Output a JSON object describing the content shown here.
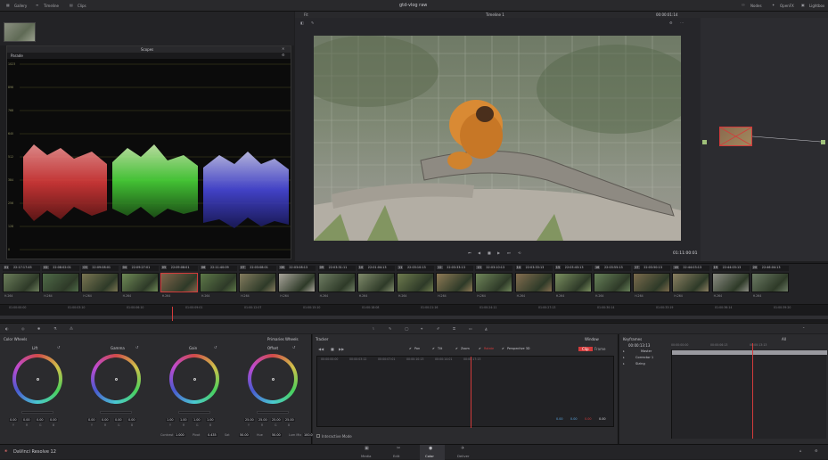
{
  "top_bar": {
    "gallery": "Gallery",
    "timeline": "Timeline",
    "clips": "Clips",
    "project_title": "gtd-vlog raw",
    "nodes": "Nodes",
    "openfx": "OpenFX",
    "lightbox": "Lightbox"
  },
  "scopes": {
    "title": "Scopes",
    "mode": "Parade",
    "y_labels": [
      "1023",
      "896",
      "768",
      "640",
      "512",
      "384",
      "256",
      "128",
      "0"
    ]
  },
  "viewer": {
    "zoom": "Fit",
    "timeline_name": "Timeline 1",
    "timecode_top": "00:00:01:14",
    "timecode": "01:11:00:01"
  },
  "clips": [
    {
      "num": "01",
      "tc": "22:17:17:45",
      "codec": "H.264",
      "color": "#6b7d5a"
    },
    {
      "num": "02",
      "tc": "22:08:02:01",
      "codec": "H.264",
      "color": "#4f6a48"
    },
    {
      "num": "03",
      "tc": "22:09:08:01",
      "codec": "H.264",
      "color": "#7a7552"
    },
    {
      "num": "04",
      "tc": "22:09:27:01",
      "codec": "H.264",
      "color": "#6f8a56"
    },
    {
      "num": "05",
      "tc": "22:09:08:01",
      "codec": "H.264",
      "color": "#80644a"
    },
    {
      "num": "06",
      "tc": "22:11:40:09",
      "codec": "H.264",
      "color": "#5d7848"
    },
    {
      "num": "07",
      "tc": "22:03:08:01",
      "codec": "H.264",
      "color": "#837b5e"
    },
    {
      "num": "08",
      "tc": "22:03:08:13",
      "codec": "H.264",
      "color": "#a8a49a"
    },
    {
      "num": "09",
      "tc": "22:03:31:11",
      "codec": "H.264",
      "color": "#6e7c62"
    },
    {
      "num": "10",
      "tc": "22:01:04:13",
      "codec": "H.264",
      "color": "#7f8a6a"
    },
    {
      "num": "11",
      "tc": "22:03:10:13",
      "codec": "H.264",
      "color": "#6d7a4d"
    },
    {
      "num": "12",
      "tc": "22:03:33:13",
      "codec": "H.264",
      "color": "#8e7a55"
    },
    {
      "num": "13",
      "tc": "22:03:10:13",
      "codec": "H.264",
      "color": "#6f8559"
    },
    {
      "num": "14",
      "tc": "22:03:33:13",
      "codec": "H.264",
      "color": "#836d4f"
    },
    {
      "num": "15",
      "tc": "22:03:43:13",
      "codec": "H.264",
      "color": "#7a8f5f"
    },
    {
      "num": "16",
      "tc": "22:03:55:13",
      "codec": "H.264",
      "color": "#668058"
    },
    {
      "num": "17",
      "tc": "22:03:50:13",
      "codec": "H.264",
      "color": "#7a6a4c"
    },
    {
      "num": "18",
      "tc": "22:44:03:13",
      "codec": "H.264",
      "color": "#8a7f61"
    },
    {
      "num": "19",
      "tc": "22:44:03:13",
      "codec": "H.264",
      "color": "#8b8c83"
    },
    {
      "num": "20",
      "tc": "22:46:04:13",
      "codec": "H.264",
      "color": "#6b7a63"
    }
  ],
  "ruler": [
    "01:00:00:00",
    "01:00:03:10",
    "01:00:06:10",
    "01:00:09:01",
    "01:00:12:07",
    "01:00:15:10",
    "01:00:18:08",
    "01:00:21:16",
    "01:00:24:11",
    "01:00:27:13",
    "01:00:30:14",
    "01:00:33:19",
    "01:00:36:14",
    "01:00:39:20"
  ],
  "color_wheels": {
    "title": "Color Wheels",
    "mode": "Primaries Wheels",
    "wheels": [
      {
        "name": "Lift",
        "vals": [
          "0.00",
          "0.00",
          "0.00",
          "0.00"
        ]
      },
      {
        "name": "Gamma",
        "vals": [
          "0.00",
          "0.00",
          "0.00",
          "0.00"
        ]
      },
      {
        "name": "Gain",
        "vals": [
          "1.00",
          "1.00",
          "1.00",
          "1.00"
        ]
      },
      {
        "name": "Offset",
        "vals": [
          "25.00",
          "25.00",
          "25.00",
          "25.00"
        ]
      }
    ],
    "channel_labels": [
      "Y",
      "R",
      "G",
      "B"
    ],
    "footer": [
      {
        "label": "Contrast",
        "value": "1.000"
      },
      {
        "label": "Pivot",
        "value": "0.435"
      },
      {
        "label": "Sat",
        "value": "50.00"
      },
      {
        "label": "Hue",
        "value": "50.00"
      },
      {
        "label": "Lum Mix",
        "value": "100.00"
      }
    ]
  },
  "tracker": {
    "title": "Tracker",
    "window": "Window",
    "options": [
      "Pan",
      "Tilt",
      "Zoom",
      "Rotate",
      "Perspective 3D"
    ],
    "clip_label": "Clip",
    "frame_label": "Frame",
    "times": [
      "00:00:00:00",
      "00:00:03:12",
      "00:00:07:01",
      "00:00:10:13",
      "00:00:14:01",
      "00:00:17:13"
    ],
    "values": [
      "0.00",
      "0.00",
      "0.00",
      "0.00"
    ],
    "interactive_mode": "Interactive Mode"
  },
  "keyframes": {
    "title": "Keyframes",
    "scope": "All",
    "timecode": "00:00:13:13",
    "tracks": [
      "Master",
      "Corrector 1",
      "Sizing"
    ],
    "ruler": [
      "00:00:00:00",
      "00:00:06:13",
      "00:00:13:13"
    ]
  },
  "bottom": {
    "app_name": "DaVinci Resolve 12",
    "pages": [
      "Media",
      "Edit",
      "Color",
      "Deliver"
    ]
  },
  "colors": {
    "accent_red": "#d33b3b",
    "panel": "#29292c",
    "background": "#1e1e20"
  }
}
